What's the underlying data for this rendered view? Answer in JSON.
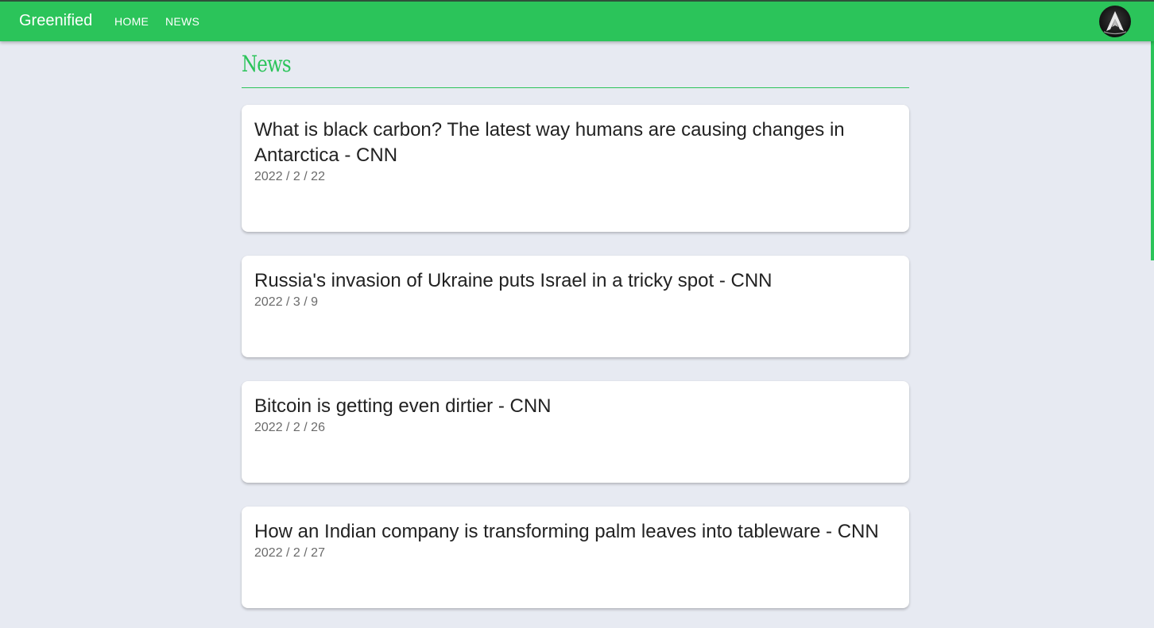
{
  "header": {
    "brand": "Greenified",
    "nav": [
      {
        "label": "HOME"
      },
      {
        "label": "NEWS"
      }
    ],
    "avatar_icon": "assassin-emblem-icon"
  },
  "page": {
    "title": "News"
  },
  "articles": [
    {
      "title": "What is black carbon? The latest way humans are causing changes in Antarctica - CNN",
      "date": "2022 / 2 / 22"
    },
    {
      "title": "Russia's invasion of Ukraine puts Israel in a tricky spot - CNN",
      "date": "2022 / 3 / 9"
    },
    {
      "title": "Bitcoin is getting even dirtier - CNN",
      "date": "2022 / 2 / 26"
    },
    {
      "title": "How an Indian company is transforming palm leaves into tableware - CNN",
      "date": "2022 / 2 / 27"
    }
  ],
  "colors": {
    "accent": "#2bc45a",
    "background": "#e7eaf2",
    "card": "#ffffff",
    "text": "#222222",
    "muted": "#6b6b6b"
  }
}
